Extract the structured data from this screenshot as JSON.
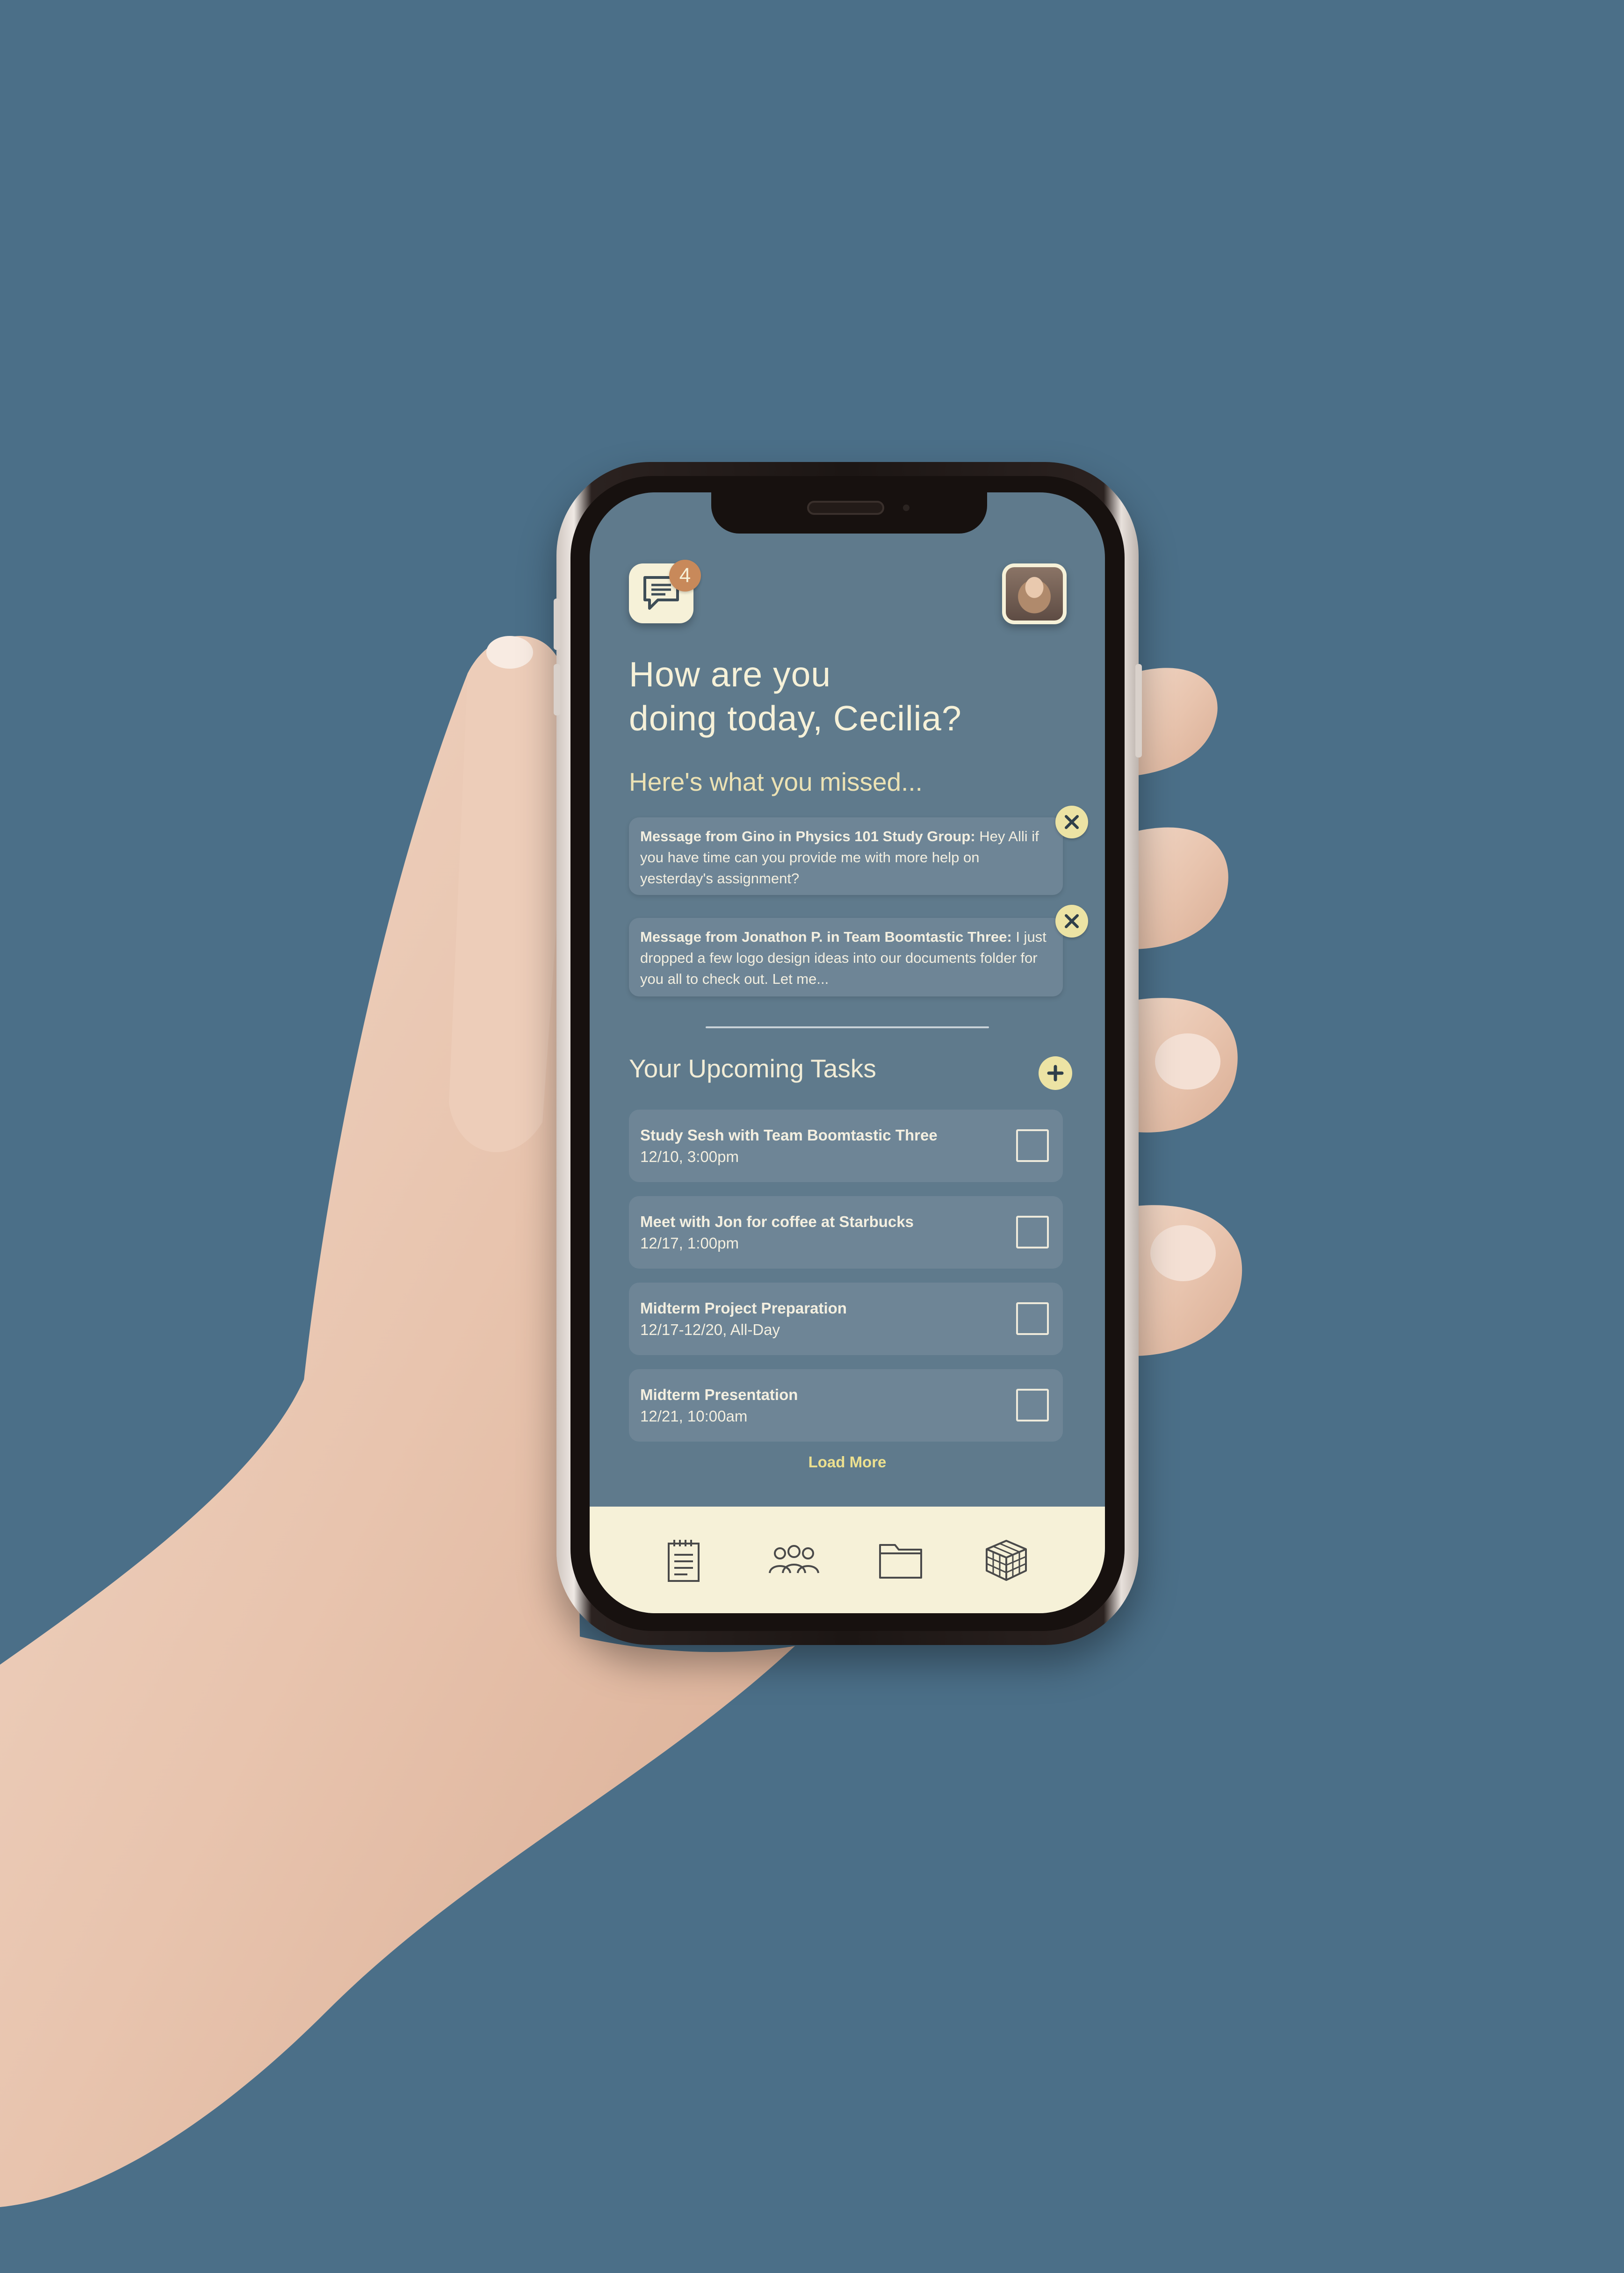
{
  "colors": {
    "background": "#4b6f88",
    "screen": "#5f7a8c",
    "card": "#6e8596",
    "cream": "#f6f1d8",
    "accent_yellow": "#ece3a4",
    "badge": "#c8895a",
    "load_more": "#ece08f"
  },
  "header": {
    "messages_icon": "chat-bubble-icon",
    "unread_count": "4",
    "avatar_icon": "user-avatar"
  },
  "greeting": {
    "line1": "How are you",
    "line2": "doing today, Cecilia?"
  },
  "missed": {
    "heading": "Here's what you missed...",
    "messages": [
      {
        "sender_line": "Message from Gino in Physics 101 Study Group:",
        "body": "Hey Alli if you have time can you provide me with more help on yesterday's assignment?"
      },
      {
        "sender_line": "Message from Jonathon P. in Team Boomtastic Three:",
        "body": "I just dropped a few logo design ideas into our documents folder for you all to check out. Let me..."
      }
    ]
  },
  "tasks": {
    "heading": "Your Upcoming Tasks",
    "items": [
      {
        "title": "Study Sesh with Team Boomtastic Three",
        "date": "12/10, 3:00pm"
      },
      {
        "title": "Meet with Jon for coffee at Starbucks",
        "date": "12/17, 1:00pm"
      },
      {
        "title": "Midterm Project Preparation",
        "date": "12/17-12/20, All-Day"
      },
      {
        "title": "Midterm Presentation",
        "date": "12/21, 10:00am"
      }
    ],
    "load_more": "Load More"
  },
  "nav": {
    "items": [
      "notepad-icon",
      "group-icon",
      "folder-icon",
      "cube-icon"
    ]
  }
}
